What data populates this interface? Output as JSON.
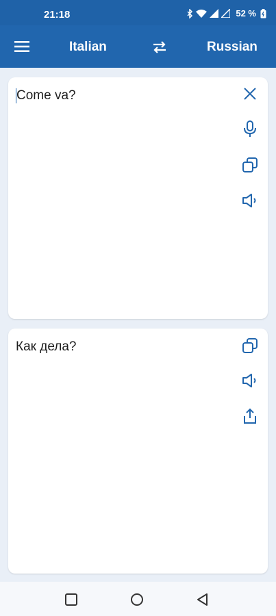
{
  "status_bar": {
    "time": "21:18",
    "battery": "52 %",
    "icons": [
      "bluetooth-icon",
      "wifi-icon",
      "signal-icon",
      "signal-icon",
      "battery-icon"
    ]
  },
  "app_bar": {
    "source_language": "Italian",
    "target_language": "Russian",
    "icons": [
      "menu-icon",
      "swap-icon"
    ]
  },
  "input_card": {
    "text": "Come va?",
    "actions": [
      "close-icon",
      "microphone-icon",
      "copy-icon",
      "speaker-icon"
    ]
  },
  "output_card": {
    "text": "Как дела?",
    "actions": [
      "copy-icon",
      "speaker-icon",
      "share-icon"
    ]
  },
  "nav_bar": {
    "buttons": [
      "recents-button",
      "home-button",
      "back-button"
    ]
  },
  "colors": {
    "brand": "#2166ae",
    "background": "#e9eff7",
    "icon": "#2166ae"
  }
}
